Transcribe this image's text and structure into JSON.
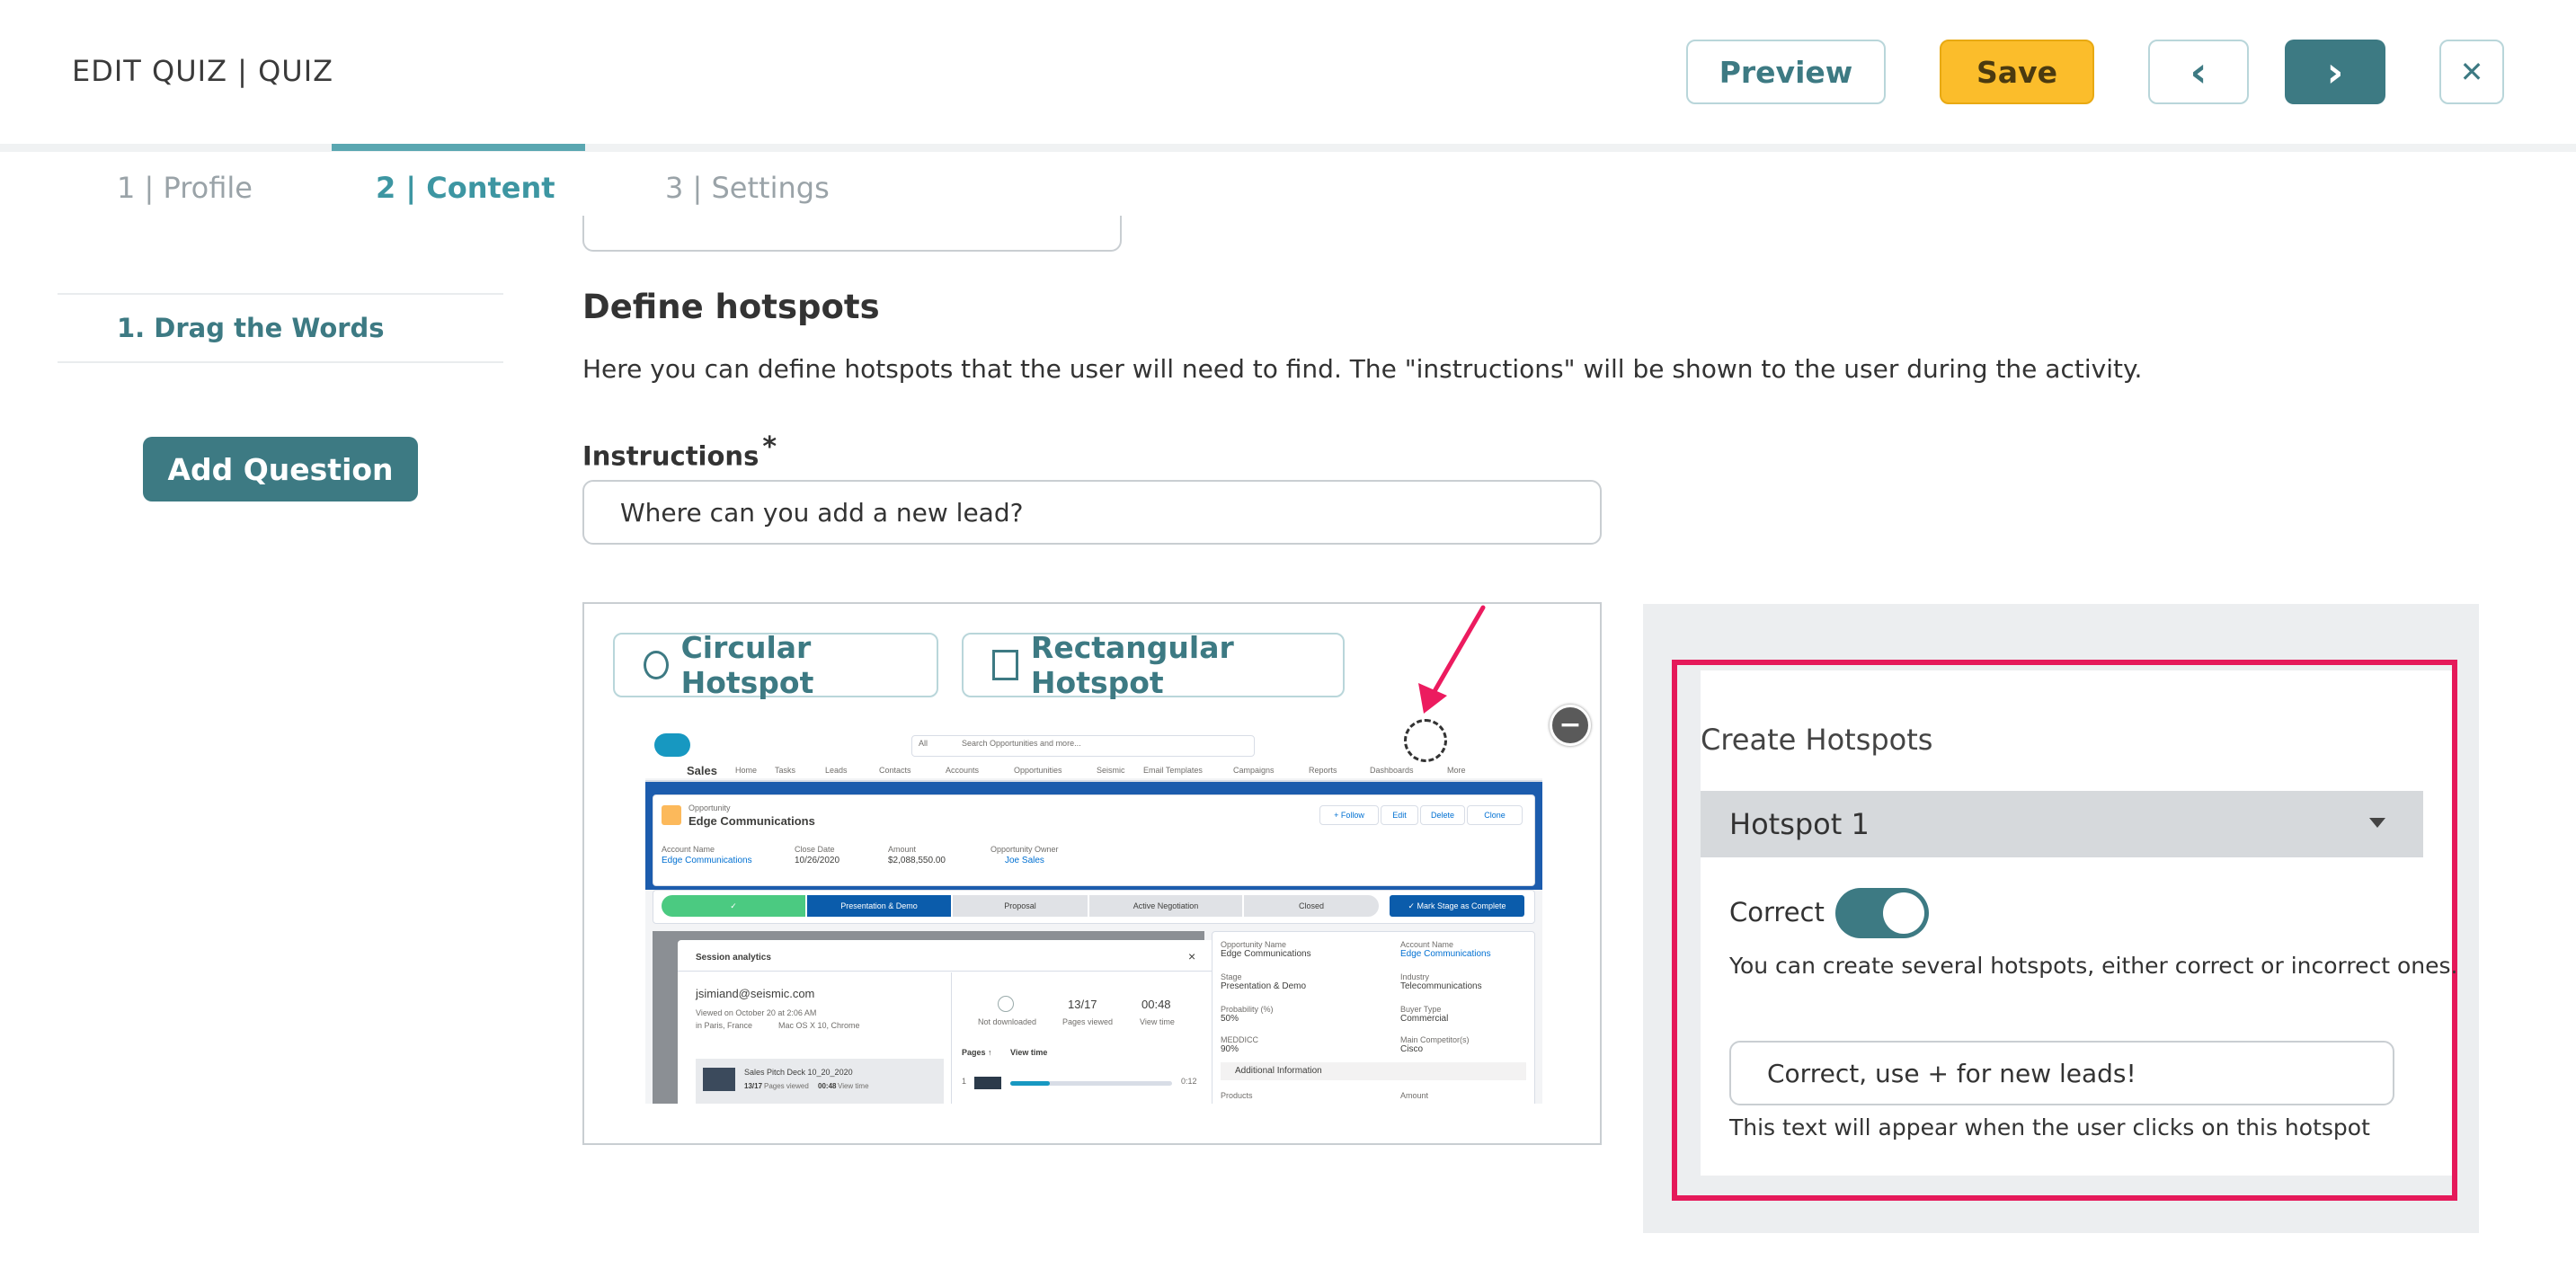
{
  "header": {
    "title": "EDIT QUIZ | QUIZ",
    "preview_label": "Preview",
    "save_label": "Save",
    "prev_icon": "‹",
    "next_icon": "›",
    "close_icon": "✕"
  },
  "tabs": [
    {
      "label": "1 | Profile",
      "active": false
    },
    {
      "label": "2 | Content",
      "active": true
    },
    {
      "label": "3 | Settings",
      "active": false
    }
  ],
  "sidebar": {
    "questions": [
      "1. Drag the Words"
    ],
    "add_label": "Add Question"
  },
  "main": {
    "heading": "Define hotspots",
    "description": "Here you can define hotspots that the user will need to find. The \"instructions\" will be shown to the user during the activity.",
    "instructions_label": "Instructions",
    "required_mark": "*",
    "instructions_value": "Where can you add a new lead?",
    "circular_label": "Circular Hotspot",
    "rectangular_label": "Rectangular Hotspot",
    "remove_icon": "−"
  },
  "salesforce": {
    "search_scope": "All",
    "search_placeholder": "Search Opportunities and more...",
    "app_name": "Sales",
    "nav": [
      "Home",
      "Tasks",
      "Leads",
      "Contacts",
      "Accounts",
      "Opportunities",
      "Seismic",
      "Email Templates",
      "Campaigns",
      "Reports",
      "Dashboards",
      "More"
    ],
    "record_type": "Opportunity",
    "record_name": "Edge Communications",
    "actions": [
      "+ Follow",
      "Edit",
      "Delete",
      "Clone"
    ],
    "fields": [
      {
        "label": "Account Name",
        "value": "Edge Communications"
      },
      {
        "label": "Close Date",
        "value": "10/26/2020"
      },
      {
        "label": "Amount",
        "value": "$2,088,550.00"
      },
      {
        "label": "Opportunity Owner",
        "value": "Joe Sales"
      }
    ],
    "path": [
      "✓",
      "Presentation & Demo",
      "Proposal",
      "Active Negotiation",
      "Closed"
    ],
    "mark_complete": "✓ Mark Stage as Complete",
    "session": {
      "title": "Session analytics",
      "close": "×",
      "email": "jsimiand@seismic.com",
      "viewed": "Viewed on October 20 at 2:06 AM",
      "location": "in Paris, France",
      "device": "Mac OS X 10, Chrome",
      "not_downloaded": "Not downloaded",
      "pages_viewed_value": "13/17",
      "pages_viewed_label": "Pages viewed",
      "view_time_value": "00:48",
      "view_time_label": "View time",
      "pages_col": "Pages ↑",
      "view_time_col": "View time",
      "row_num": "1",
      "row_time": "0:12",
      "deck_name": "Sales Pitch Deck 10_20_2020",
      "deck_pages": "13/17",
      "deck_pages_label": "Pages viewed",
      "deck_time": "00:48",
      "deck_time_label": "View time"
    },
    "detail": [
      {
        "label": "Opportunity Name",
        "value": "Edge Communications"
      },
      {
        "label": "Account Name",
        "value": "Edge Communications"
      },
      {
        "label": "Stage",
        "value": "Presentation & Demo"
      },
      {
        "label": "Industry",
        "value": "Telecommunications"
      },
      {
        "label": "Probability (%)",
        "value": "50%"
      },
      {
        "label": "Buyer Type",
        "value": "Commercial"
      },
      {
        "label": "MEDDICC",
        "value": "90%"
      },
      {
        "label": "Main Competitor(s)",
        "value": "Cisco"
      }
    ],
    "additional_info": "Additional Information",
    "products": "Products",
    "amount_label": "Amount"
  },
  "hotspots_panel": {
    "title": "Create Hotspots",
    "selected": "Hotspot 1",
    "correct_label": "Correct",
    "correct": true,
    "help": "You can create several hotspots, either correct or incorrect ones.",
    "feedback_value": "Correct, use + for new leads!",
    "feedback_help": "This text will appear when the user clicks on this hotspot"
  },
  "colors": {
    "accent": "#3d7a83",
    "save": "#fbbd2b",
    "highlight": "#e5195a",
    "salesforce_blue": "#1c5cad"
  }
}
